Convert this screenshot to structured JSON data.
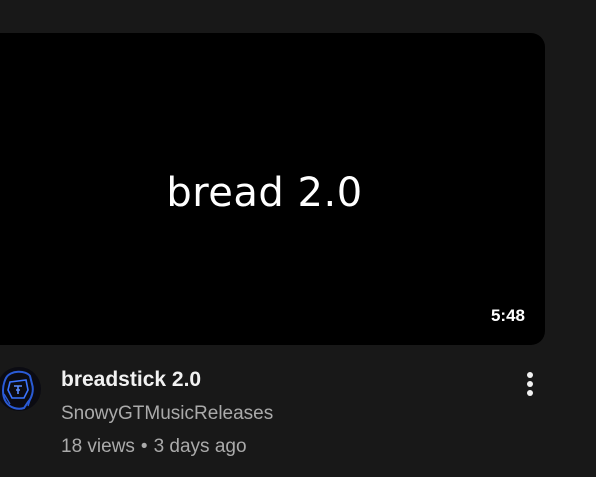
{
  "video": {
    "thumbnail_text": "bread 2.0",
    "duration": "5:48",
    "title": "breadstick 2.0",
    "channel": "SnowyGTMusicReleases",
    "views": "18 views",
    "separator": "•",
    "age": "3 days ago"
  },
  "icons": {
    "avatar": "channel-avatar",
    "menu": "more-vertical-icon"
  },
  "colors": {
    "background": "#181818",
    "thumbnail": "#000000",
    "title": "#f1f1f1",
    "secondary": "#aaaaaa",
    "avatar_accent": "#2a5bd7"
  }
}
